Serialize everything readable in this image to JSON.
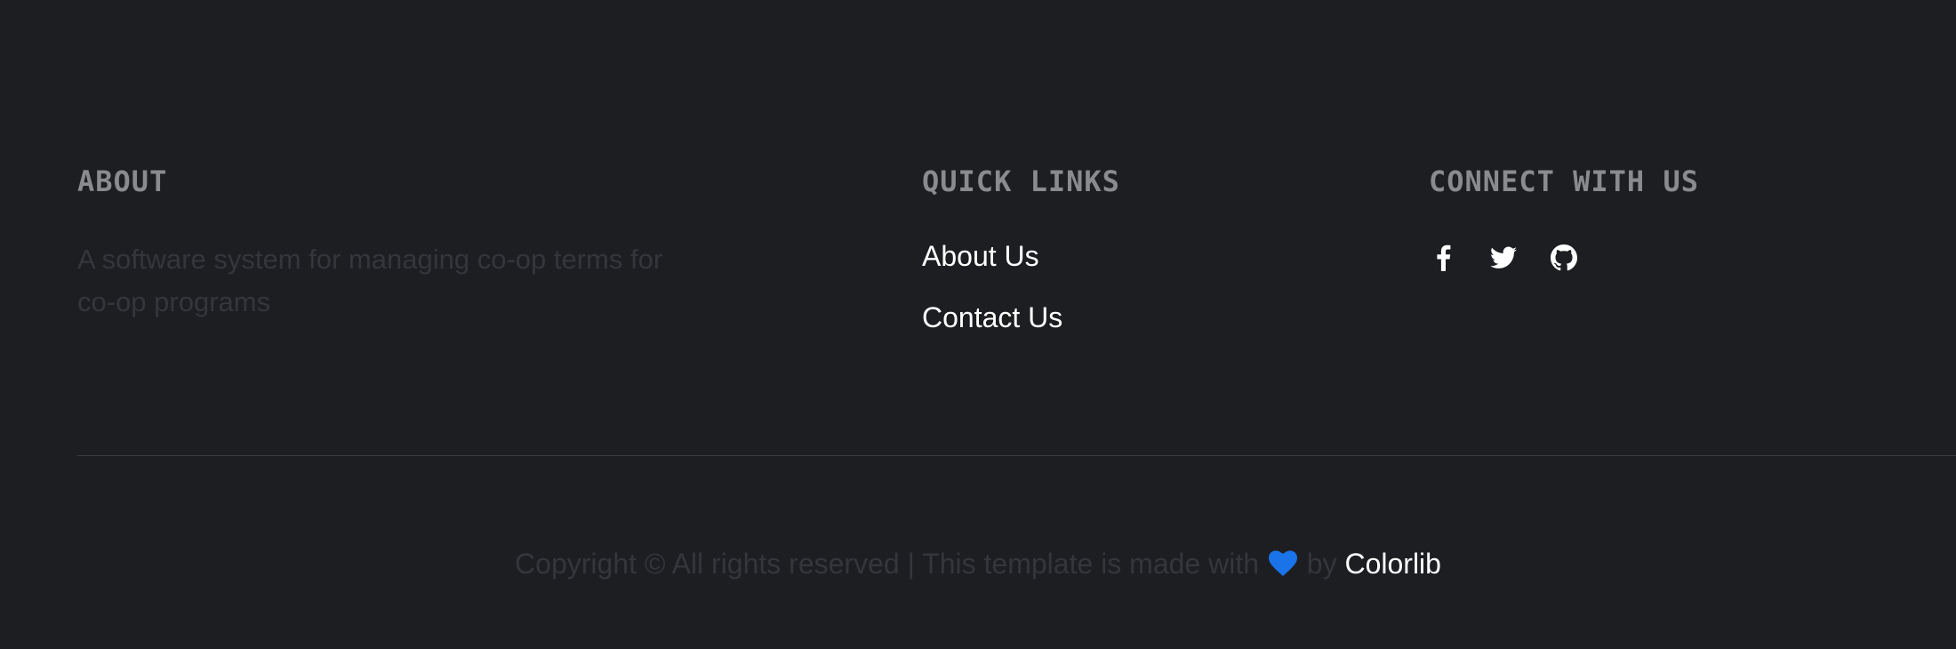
{
  "about": {
    "heading": "ABOUT",
    "text": "A software system for managing co-op terms for co-op programs"
  },
  "quick_links": {
    "heading": "QUICK LINKS",
    "items": [
      "About Us",
      "Contact Us"
    ]
  },
  "connect": {
    "heading": "CONNECT WITH US",
    "icons": [
      "facebook-icon",
      "twitter-icon",
      "github-icon"
    ]
  },
  "copyright": {
    "prefix": "Copyright © All rights reserved | This template is made with",
    "by": "by",
    "link": "Colorlib"
  },
  "colors": {
    "background": "#1d1e22",
    "heart": "#1a73e8",
    "heading": "#8a8b8f",
    "muted_text": "#34363c"
  }
}
